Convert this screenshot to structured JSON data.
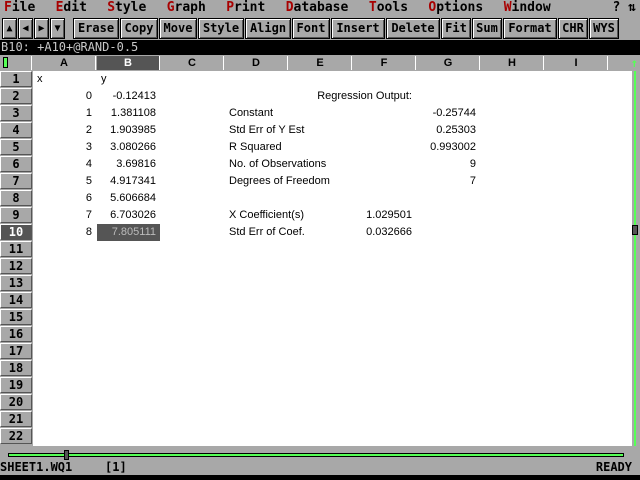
{
  "menu": [
    "File",
    "Edit",
    "Style",
    "Graph",
    "Print",
    "Database",
    "Tools",
    "Options",
    "Window"
  ],
  "help": "? ⇅",
  "nav_buttons": [
    {
      "name": "up",
      "glyph": "▲"
    },
    {
      "name": "left",
      "glyph": "◀"
    },
    {
      "name": "right",
      "glyph": "▶"
    },
    {
      "name": "down",
      "glyph": "▼"
    }
  ],
  "toolbar": [
    "Erase",
    "Copy",
    "Move",
    "Style",
    "Align",
    "Font",
    "Insert",
    "Delete",
    "Fit",
    "Sum",
    "Format",
    "CHR",
    "WYS"
  ],
  "formula": "B10: +A10+@RAND-0.5",
  "columns": [
    "A",
    "B",
    "C",
    "D",
    "E",
    "F",
    "G",
    "H",
    "I"
  ],
  "selected_col": "B",
  "selected_row": 10,
  "rows": 22,
  "cells": [
    {
      "row": 1,
      "col": 0,
      "text": "x",
      "align": "l"
    },
    {
      "row": 1,
      "col": 1,
      "text": "y",
      "align": "l"
    },
    {
      "row": 2,
      "col": 0,
      "text": "0",
      "align": "r"
    },
    {
      "row": 2,
      "col": 1,
      "text": "-0.12413",
      "align": "r"
    },
    {
      "row": 3,
      "col": 0,
      "text": "1",
      "align": "r"
    },
    {
      "row": 3,
      "col": 1,
      "text": "1.381108",
      "align": "r"
    },
    {
      "row": 4,
      "col": 0,
      "text": "2",
      "align": "r"
    },
    {
      "row": 4,
      "col": 1,
      "text": "1.903985",
      "align": "r"
    },
    {
      "row": 5,
      "col": 0,
      "text": "3",
      "align": "r"
    },
    {
      "row": 5,
      "col": 1,
      "text": "3.080266",
      "align": "r"
    },
    {
      "row": 6,
      "col": 0,
      "text": "4",
      "align": "r"
    },
    {
      "row": 6,
      "col": 1,
      "text": "3.69816",
      "align": "r"
    },
    {
      "row": 7,
      "col": 0,
      "text": "5",
      "align": "r"
    },
    {
      "row": 7,
      "col": 1,
      "text": "4.917341",
      "align": "r"
    },
    {
      "row": 8,
      "col": 0,
      "text": "6",
      "align": "r"
    },
    {
      "row": 8,
      "col": 1,
      "text": "5.606684",
      "align": "r"
    },
    {
      "row": 9,
      "col": 0,
      "text": "7",
      "align": "r"
    },
    {
      "row": 9,
      "col": 1,
      "text": "6.703026",
      "align": "r"
    },
    {
      "row": 10,
      "col": 0,
      "text": "8",
      "align": "r"
    },
    {
      "row": 10,
      "col": 1,
      "text": "7.805111",
      "align": "r"
    },
    {
      "row": 2,
      "col": 5,
      "text": "Regression Output:",
      "align": "r"
    },
    {
      "row": 3,
      "col": 3,
      "text": "Constant",
      "align": "l"
    },
    {
      "row": 3,
      "col": 6,
      "text": "-0.25744",
      "align": "r"
    },
    {
      "row": 4,
      "col": 3,
      "text": "Std Err of Y Est",
      "align": "l"
    },
    {
      "row": 4,
      "col": 6,
      "text": "0.25303",
      "align": "r"
    },
    {
      "row": 5,
      "col": 3,
      "text": "R Squared",
      "align": "l"
    },
    {
      "row": 5,
      "col": 6,
      "text": "0.993002",
      "align": "r"
    },
    {
      "row": 6,
      "col": 3,
      "text": "No. of Observations",
      "align": "l"
    },
    {
      "row": 6,
      "col": 6,
      "text": "9",
      "align": "r"
    },
    {
      "row": 7,
      "col": 3,
      "text": "Degrees of Freedom",
      "align": "l"
    },
    {
      "row": 7,
      "col": 6,
      "text": "7",
      "align": "r"
    },
    {
      "row": 9,
      "col": 3,
      "text": "X Coefficient(s)",
      "align": "l"
    },
    {
      "row": 9,
      "col": 5,
      "text": "1.029501",
      "align": "r"
    },
    {
      "row": 10,
      "col": 3,
      "text": "Std Err of Coef.",
      "align": "l"
    },
    {
      "row": 10,
      "col": 5,
      "text": "0.032666",
      "align": "r"
    }
  ],
  "status": {
    "file": "SHEET1.WQ1",
    "window": "[1]",
    "mode": "READY"
  },
  "colors": {
    "hotkey": "#a80000",
    "scroll": "#55ff55",
    "selected": "#555555"
  }
}
